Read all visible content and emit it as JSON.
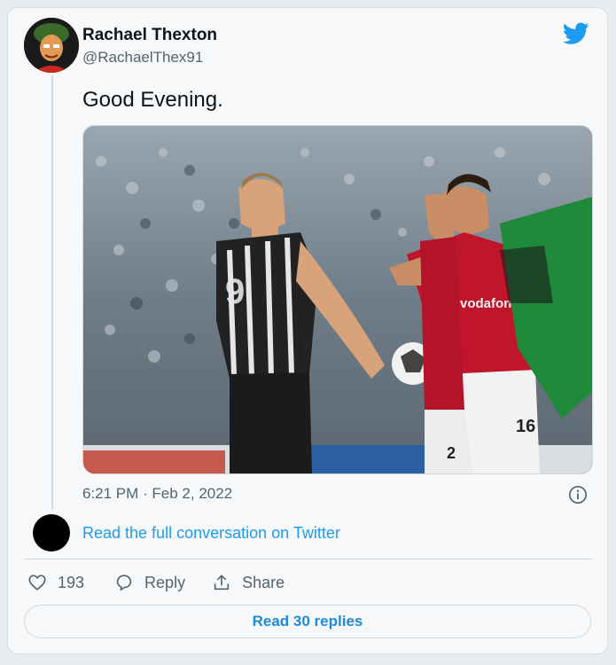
{
  "author": {
    "display_name": "Rachael Thexton",
    "handle": "@RachaelThex91"
  },
  "tweet": {
    "text": "Good Evening.",
    "timestamp": "6:21 PM · Feb 2, 2022",
    "media": {
      "shirt_text": "vodafone",
      "shirt_numbers": [
        "9",
        "2",
        "16"
      ]
    }
  },
  "conversation_link": "Read the full conversation on Twitter",
  "actions": {
    "like_count": "193",
    "reply_label": "Reply",
    "share_label": "Share"
  },
  "read_replies_label": "Read 30 replies",
  "icons": [
    "twitter-bird-icon",
    "info-icon",
    "heart-icon",
    "reply-bubble-icon",
    "share-icon"
  ],
  "colors": {
    "brand_blue": "#1d9bf0",
    "text_primary": "#0f1419",
    "text_secondary": "#536471",
    "border": "#cfd9de"
  }
}
